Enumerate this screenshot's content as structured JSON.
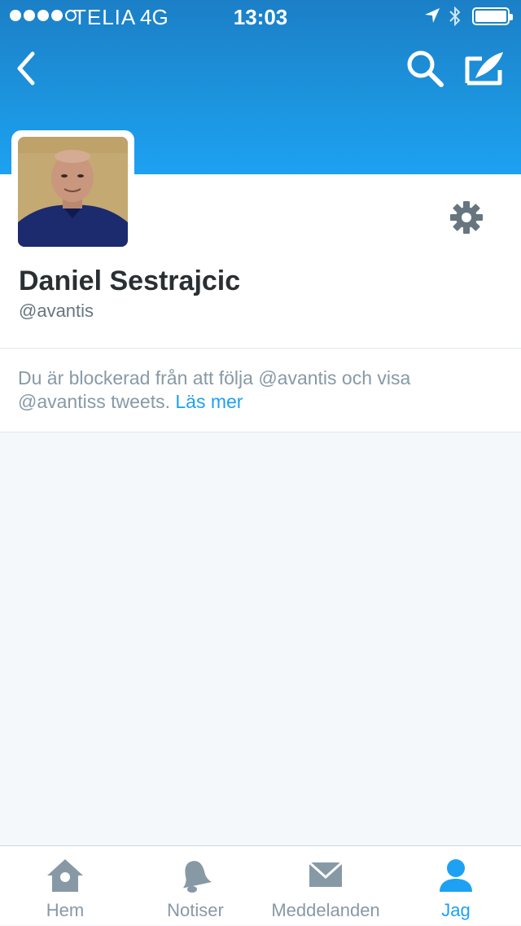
{
  "status_bar": {
    "carrier": "TELIA",
    "network": "4G",
    "time": "13:03"
  },
  "nav": {
    "back_icon": "chevron-left-icon",
    "search_icon": "search-icon",
    "compose_icon": "compose-icon"
  },
  "profile": {
    "name": "Daniel Sestrajcic",
    "handle": "@avantis",
    "settings_icon": "gear-icon"
  },
  "blocked_notice": {
    "text": "Du är blockerad från att följa @avantis och visa @avantiss tweets.",
    "link": "Läs mer"
  },
  "tabbar": {
    "tabs": [
      {
        "label": "Hem",
        "icon": "home-icon"
      },
      {
        "label": "Notiser",
        "icon": "bell-icon"
      },
      {
        "label": "Meddelanden",
        "icon": "envelope-icon"
      },
      {
        "label": "Jag",
        "icon": "person-icon",
        "active": true
      }
    ]
  },
  "colors": {
    "accent": "#1da1f2",
    "header_top": "#1b7fc6",
    "muted_text": "#8899a6",
    "dark_text": "#292f33"
  }
}
